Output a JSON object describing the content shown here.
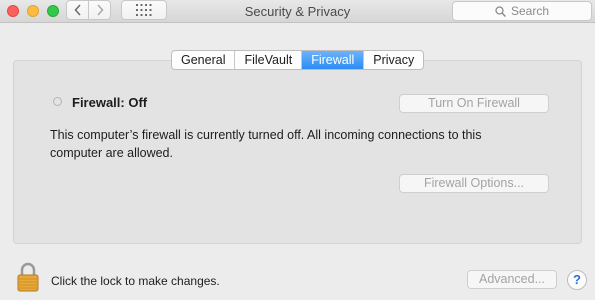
{
  "window": {
    "title": "Security & Privacy",
    "search_placeholder": "Search"
  },
  "tabs": [
    {
      "label": "General",
      "active": false
    },
    {
      "label": "FileVault",
      "active": false
    },
    {
      "label": "Firewall",
      "active": true
    },
    {
      "label": "Privacy",
      "active": false
    }
  ],
  "firewall": {
    "status": "Firewall: Off",
    "turn_on_label": "Turn On Firewall",
    "description": "This computer’s firewall is currently turned off. All incoming connections to this computer are allowed.",
    "options_label": "Firewall Options..."
  },
  "footer": {
    "lock_text": "Click the lock to make changes.",
    "advanced_label": "Advanced...",
    "help_label": "?"
  },
  "icons": {
    "back": "chevron-left-icon",
    "forward": "chevron-right-icon",
    "grid": "grid-icon",
    "search": "search-icon",
    "lock": "lock-icon"
  },
  "colors": {
    "active_tab": "#2c8cf4",
    "close": "#fc605c",
    "minimize": "#fdbc40",
    "maximize": "#34c84a"
  }
}
